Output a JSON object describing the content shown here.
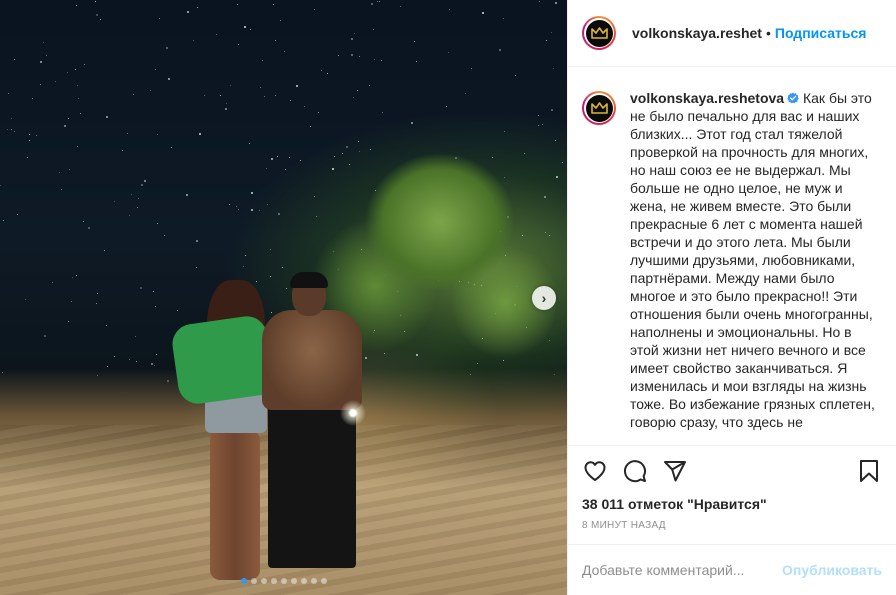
{
  "post": {
    "carousel_pages": 9,
    "carousel_active": 0
  },
  "header": {
    "username": "volkonskaya.reshet",
    "separator": "•",
    "follow_label": "Подписаться"
  },
  "caption": {
    "username": "volkonskaya.reshetova",
    "text": "Как бы это не было печально для вас и наших близких... Этот год стал тяжелой проверкой на прочность для многих, но наш союз ее не выдержал. Мы больше не одно целое, не муж и жена, не живем вместе. Это были прекрасные 6 лет с момента нашей встречи и до этого лета. Мы были лучшими друзьями, любовниками, партнёрами. Между нами было многое и это было прекрасно!! Эти отношения были очень многогранны, наполнены и эмоциональны. Но в этой жизни нет ничего вечного и все имеет свойство заканчиваться. Я изменилась и мои взгляды на жизнь тоже. Во избежание грязных сплетен, говорю сразу, что здесь не"
  },
  "actions": {
    "likes": "38 011 отметок \"Нравится\"",
    "time": "8 минут назад"
  },
  "comment": {
    "placeholder": "Добавьте комментарий...",
    "publish_label": "Опубликовать"
  },
  "colors": {
    "accent": "#0095f6",
    "publish_disabled": "#b2dffc",
    "verified": "#3897f0",
    "text": "#262626",
    "muted": "#8e8e8e"
  },
  "icons": {
    "next": "chevron-right-icon",
    "like": "heart-icon",
    "comment": "comment-icon",
    "share": "paper-plane-icon",
    "save": "bookmark-icon",
    "verified": "verified-badge-icon",
    "avatar": "crown-icon"
  }
}
